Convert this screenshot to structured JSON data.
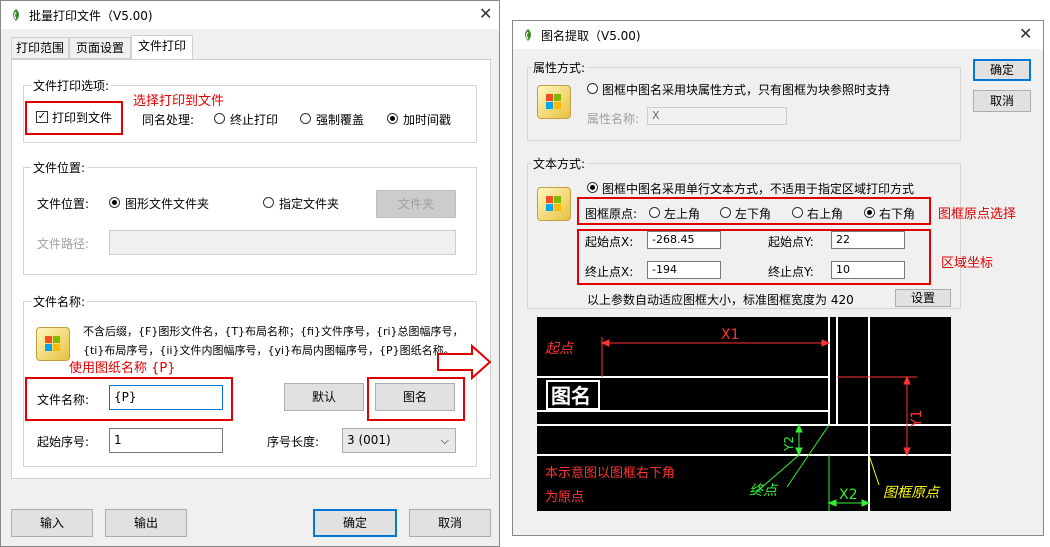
{
  "left": {
    "title": "批量打印文件（V5.00)",
    "tabs": [
      "打印范围",
      "页面设置",
      "文件打印"
    ],
    "print_options": {
      "group": "文件打印选项:",
      "print_to_file": "打印到文件",
      "annotation": "选择打印到文件",
      "same_name": "同名处理:",
      "opt_stop": "终止打印",
      "opt_overwrite": "强制覆盖",
      "opt_timestamp": "加时间戳"
    },
    "location": {
      "group": "文件位置:",
      "label": "文件位置:",
      "opt_drawing_folder": "图形文件文件夹",
      "opt_specified_folder": "指定文件夹",
      "folder_button": "文件夹",
      "path_label": "文件路径:",
      "path_value": ""
    },
    "filename": {
      "group": "文件名称:",
      "help_line1": "不含后缀，{F}图形文件名，{T}布局名称；{fi}文件序号，{ri}总图幅序号，",
      "help_line2": "{ti}布局序号，{ii}文件内图幅序号，{yi}布局内图幅序号，{P}图纸名称。",
      "annotation": "使用图纸名称 {P}",
      "name_label": "文件名称:",
      "name_value": "{P}",
      "default_button": "默认",
      "tuming_button": "图名",
      "start_label": "起始序号:",
      "start_value": "1",
      "length_label": "序号长度:",
      "length_value": "3 (001)"
    },
    "buttons": {
      "import": "输入",
      "export": "输出",
      "ok": "确定",
      "cancel": "取消"
    }
  },
  "right": {
    "title": "图名提取（V5.00)",
    "ok": "确定",
    "cancel": "取消",
    "attr": {
      "group": "属性方式:",
      "option": "图框中图名采用块属性方式，只有图框为块参照时支持",
      "name_label": "属性名称:",
      "name_value": "X"
    },
    "text": {
      "group": "文本方式:",
      "option": "图框中图名采用单行文本方式，不适用于指定区域打印方式",
      "origin_label": "图框原点:",
      "opt_ul": "左上角",
      "opt_ll": "左下角",
      "opt_ur": "右上角",
      "opt_lr": "右下角",
      "origin_annotation": "图框原点选择",
      "start_x_label": "起始点X:",
      "start_x": "-268.45",
      "start_y_label": "起始点Y:",
      "start_y": "22",
      "end_x_label": "终止点X:",
      "end_x": "-194",
      "end_y_label": "终止点Y:",
      "end_y": "10",
      "area_annotation": "区域坐标",
      "info": "以上参数自动适应图框大小，标准图框宽度为 420",
      "settings_button": "设置"
    },
    "diagram": {
      "start_label": "起点",
      "x1": "X1",
      "title_text": "图名",
      "y1": "Y1",
      "y2": "Y2",
      "x2": "X2",
      "note_line1": "本示意图以图框右下角",
      "note_line2": "为原点",
      "end_label": "终点",
      "origin_label": "图框原点"
    }
  }
}
